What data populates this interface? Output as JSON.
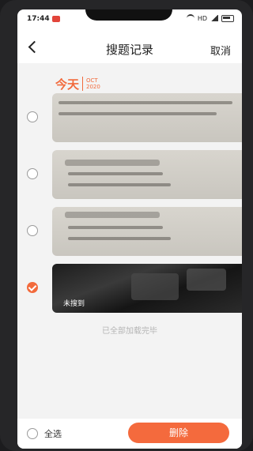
{
  "statusbar": {
    "time": "17:44",
    "right_text": "HD"
  },
  "nav": {
    "title": "搜题记录",
    "cancel": "取消"
  },
  "date_header": {
    "today": "今天",
    "month": "OCT",
    "year": "2020"
  },
  "records": [
    {
      "checked": false,
      "type": "paper"
    },
    {
      "checked": false,
      "type": "paper"
    },
    {
      "checked": false,
      "type": "paper"
    },
    {
      "checked": true,
      "type": "dark",
      "tag": "未搜到"
    }
  ],
  "footer_note": "已全部加载完毕",
  "bottom": {
    "select_all": "全选",
    "delete": "删除"
  },
  "colors": {
    "accent": "#f26a3c"
  }
}
